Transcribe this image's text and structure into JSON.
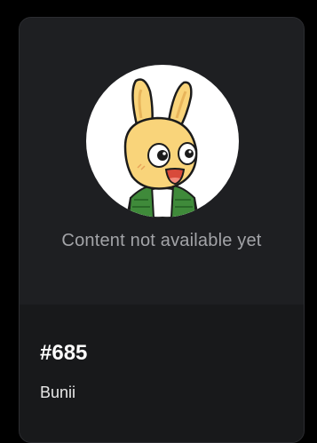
{
  "card": {
    "media": {
      "avatar_icon": "bunny-character-avatar",
      "status_text": "Content not available yet"
    },
    "info": {
      "token_id": "#685",
      "name": "Bunii"
    }
  },
  "colors": {
    "background": "#000000",
    "card_surface": "#1e1f22",
    "info_surface": "#18191b",
    "muted_text": "#a3a4a8",
    "avatar_body": "#f9d47a",
    "avatar_vest": "#3f8a3a"
  }
}
